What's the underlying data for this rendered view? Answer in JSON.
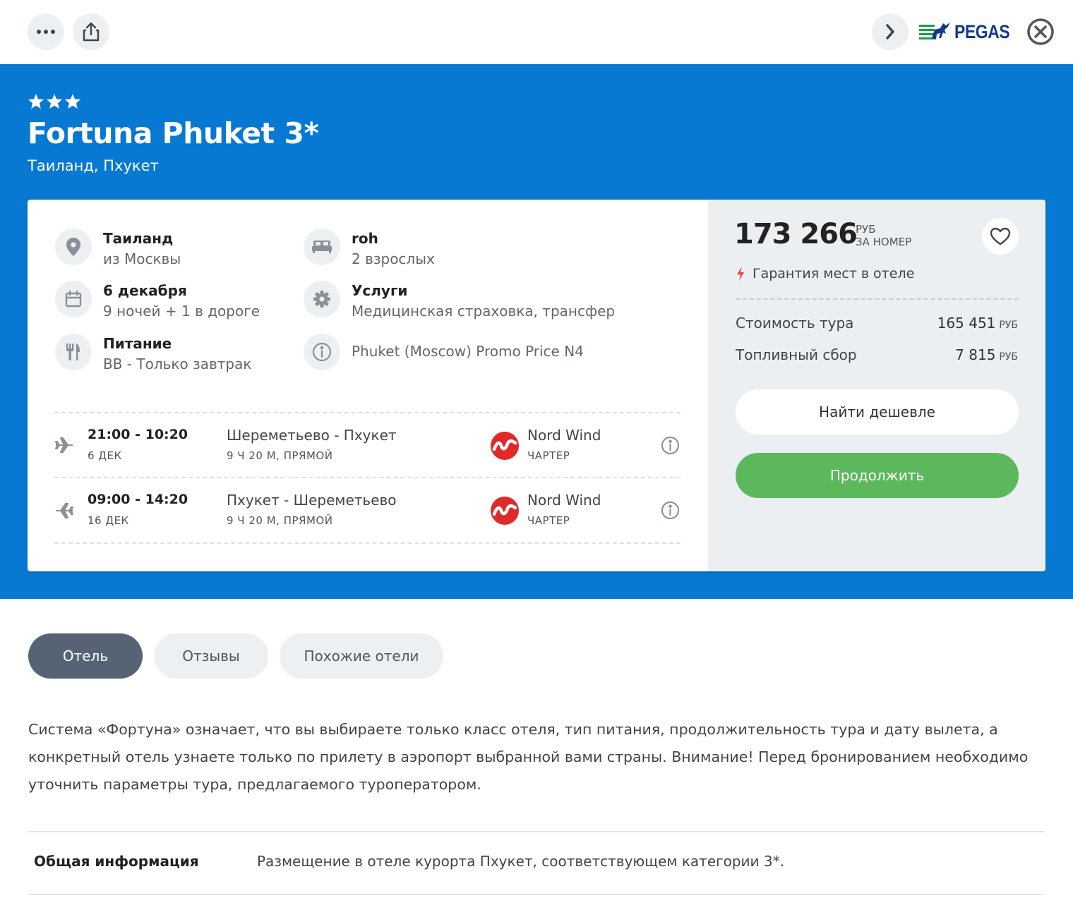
{
  "topbar": {
    "logo_text": "PEGAS",
    "icons": [
      "more-icon",
      "share-icon",
      "chevron-right-icon",
      "close-icon"
    ]
  },
  "hotel": {
    "stars": 3,
    "title": "Fortuna Phuket 3*",
    "location": "Таиланд, Пхукет"
  },
  "details": {
    "country": {
      "title": "Таиланд",
      "sub": "из Москвы"
    },
    "room": {
      "title": "roh",
      "sub": "2 взрослых"
    },
    "date": {
      "title": "6 декабря",
      "sub": "9 ночей + 1 в дороге"
    },
    "services": {
      "title": "Услуги",
      "sub": "Медицинская страховка, трансфер"
    },
    "meal": {
      "title": "Питание",
      "sub": "BB - Только завтрак"
    },
    "tariff": {
      "sub": "Phuket (Moscow) Promo Price N4"
    }
  },
  "flights": [
    {
      "time": "21:00 - 10:20",
      "date": "6 ДЕК",
      "route": "Шереметьево - Пхукет",
      "duration": "9 Ч 20 М, ПРЯМОЙ",
      "airline": "Nord Wind",
      "type": "ЧАРТЕР"
    },
    {
      "time": "09:00 - 14:20",
      "date": "16 ДЕК",
      "route": "Пхукет - Шереметьево",
      "duration": "9 Ч 20 М, ПРЯМОЙ",
      "airline": "Nord Wind",
      "type": "ЧАРТЕР"
    }
  ],
  "pricing": {
    "total": "173 266",
    "currency": "РУБ",
    "per": "ЗА НОМЕР",
    "guarantee": "Гарантия мест в отеле",
    "tour_label": "Стоимость тура",
    "tour_value": "165 451",
    "fuel_label": "Топливный сбор",
    "fuel_value": "7 815",
    "cur_small": "РУБ",
    "cheaper_label": "Найти дешевле",
    "continue_label": "Продолжить"
  },
  "tabs": [
    "Отель",
    "Отзывы",
    "Похожие отели"
  ],
  "description": "Система «Фортуна» означает, что вы выбираете только класс отеля, тип питания, продолжительность тура и дату вылета, а конкретный отель узнаете только по прилету в аэропорт выбранной вами страны. Внимание! Перед бронированием необходимо уточнить параметры тура, предлагаемого туроператором.",
  "general": {
    "label": "Общая информация",
    "text": "Размещение в отеле курорта Пхукет, соответствующем категории 3*."
  },
  "colors": {
    "hero_blue": "#0879d2",
    "continue_green": "#5cb85c",
    "active_tab": "#566374",
    "airline_red": "#e02a27"
  }
}
